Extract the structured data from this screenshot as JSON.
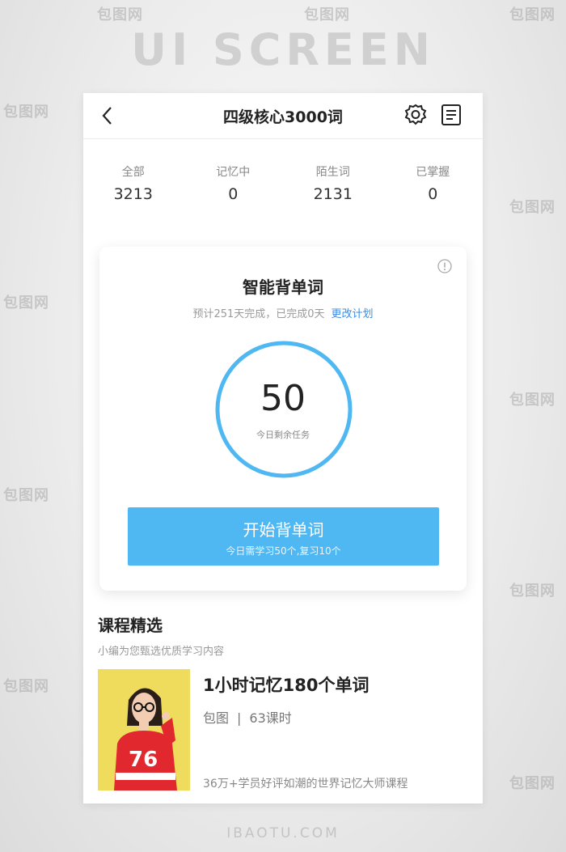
{
  "header_text": "UI SCREEN",
  "watermark": "包图网",
  "footer_text": "IBAOTU.COM",
  "nav": {
    "title": "四级核心3000词"
  },
  "stats": [
    {
      "label": "全部",
      "value": "3213"
    },
    {
      "label": "记忆中",
      "value": "0"
    },
    {
      "label": "陌生词",
      "value": "2131"
    },
    {
      "label": "已掌握",
      "value": "0"
    }
  ],
  "study_card": {
    "title": "智能背单词",
    "plan_text": "预计251天完成，已完成0天",
    "change_plan_link": "更改计划",
    "remaining_count": "50",
    "remaining_caption": "今日剩余任务",
    "start_button_label": "开始背单词",
    "start_button_sub": "今日需学习50个,复习10个"
  },
  "courses_section": {
    "title": "课程精选",
    "subtitle": "小编为您甄选优质学习内容"
  },
  "course": {
    "title": "1小时记忆180个单词",
    "author": "包图",
    "lessons": "63课时",
    "description": "36万+学员好评如潮的世界记忆大师课程"
  },
  "colors": {
    "accent": "#4fb8f2",
    "link": "#3a8ee6",
    "ring": "#4fb8f2"
  }
}
